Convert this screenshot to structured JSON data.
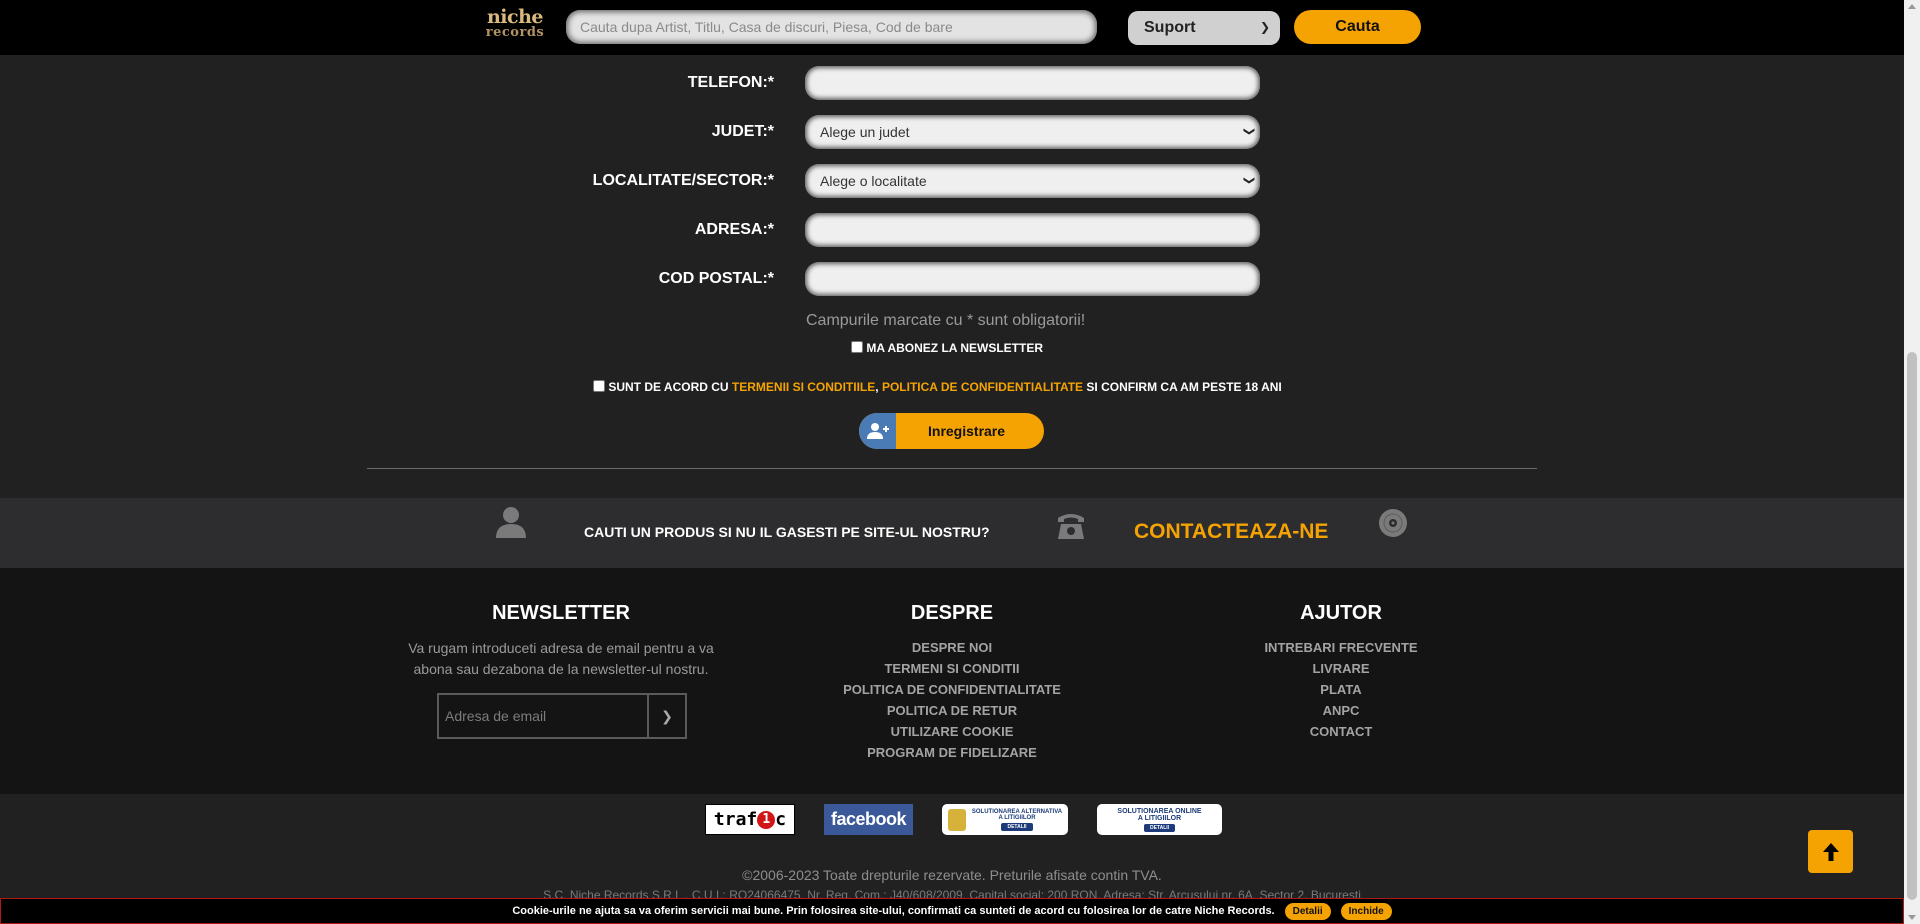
{
  "topbar": {
    "logo_line1": "niche",
    "logo_line2": "records",
    "search_placeholder": "Cauta dupa Artist, Titlu, Casa de discuri, Piesa, Cod de bare",
    "support_select": "Suport",
    "search_button": "Cauta"
  },
  "form": {
    "fields": [
      {
        "label": "TELEFON:*",
        "value": ""
      },
      {
        "label": "JUDET:*",
        "value": "Alege un judet"
      },
      {
        "label": "LOCALITATE/SECTOR:*",
        "value": "Alege o localitate"
      },
      {
        "label": "ADRESA:*",
        "value": ""
      },
      {
        "label": "COD POSTAL:*",
        "value": ""
      }
    ],
    "required_note": "Campurile marcate cu * sunt obligatorii!",
    "newsletter_checkbox": "MA ABONEZ LA NEWSLETTER",
    "terms_prefix": "SUNT DE ACORD CU",
    "terms_link": "TERMENII SI CONDITIILE",
    "terms_comma": ",",
    "privacy_link": "POLITICA DE CONFIDENTIALITATE",
    "terms_suffix": "SI CONFIRM CA AM PESTE 18 ANI",
    "register_button": "Inregistrare"
  },
  "contact_band": {
    "question": "CAUTI UN PRODUS SI NU IL GASESTI PE SITE-UL NOSTRU?",
    "cta": "CONTACTEAZA-NE"
  },
  "footer": {
    "newsletter": {
      "title": "NEWSLETTER",
      "description": "Va rugam introduceti adresa de email pentru a va abona sau dezabona de la newsletter-ul nostru.",
      "email_placeholder": "Adresa de email"
    },
    "despre": {
      "title": "DESPRE",
      "links": [
        "DESPRE NOI",
        "TERMENI SI CONDITII",
        "POLITICA DE CONFIDENTIALITATE",
        "POLITICA DE RETUR",
        "UTILIZARE COOKIE",
        "PROGRAM DE FIDELIZARE"
      ]
    },
    "ajutor": {
      "title": "AJUTOR",
      "links": [
        "INTREBARI FRECVENTE",
        "LIVRARE",
        "PLATA",
        "ANPC",
        "CONTACT"
      ]
    }
  },
  "badges": {
    "trafic_a": "traf",
    "trafic_b": "1",
    "trafic_c": "c",
    "facebook": "facebook",
    "sal_line1": "SOLUTIONAREA ALTERNATIVA",
    "sal_line2": "A LITIGIILOR",
    "sal_detail": "DETALII",
    "sol_line1": "SOLUTIONAREA ONLINE",
    "sol_line2": "A LITIGIILOR",
    "sol_detail": "DETALII"
  },
  "copyright": {
    "text": "©2006-2023 Toate drepturile rezervate. Preturile afisate contin TVA.",
    "company": "S.C. Niche Records S.R.L., C.U.I.: RO24066475, Nr. Reg. Com.: J40/608/2009, Capital social: 200 RON, Adresa: Str. Arcusului nr. 6A, Sector 2, Bucuresti"
  },
  "cookie": {
    "text": "Cookie-urile ne ajuta sa va oferim servicii mai bune. Prin folosirea site-ului, confirmati ca sunteti de acord cu folosirea lor de catre Niche Records.",
    "details": "Detalii",
    "close": "Inchide"
  },
  "colors": {
    "accent": "#f5a302",
    "background": "#212121",
    "topbar": "#000000",
    "footer": "#141414"
  }
}
